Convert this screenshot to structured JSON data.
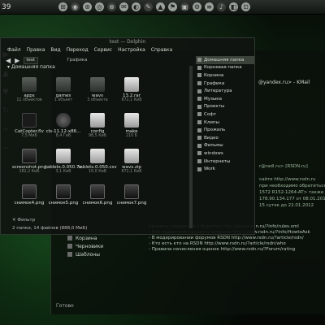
{
  "top_panel": {
    "time": "39",
    "icons": [
      "app-icon-1",
      "app-icon-2",
      "app-icon-3",
      "app-icon-4",
      "app-icon-5",
      "app-icon-6",
      "app-icon-7",
      "app-icon-8",
      "app-icon-9",
      "app-icon-10",
      "app-icon-11",
      "app-icon-12",
      "app-icon-13",
      "app-icon-14",
      "app-icon-15",
      "app-icon-16"
    ]
  },
  "fm": {
    "title": "test — Dolphin",
    "menu": [
      "Файл",
      "Правка",
      "Вид",
      "Переход",
      "Сервис",
      "Настройка",
      "Справка"
    ],
    "location": "test",
    "breadcrumb": "Графика",
    "home_label": "Домашняя папка",
    "files": [
      {
        "name": "apps",
        "size": "11 объектов",
        "icon": "folder"
      },
      {
        "name": "games",
        "size": "1 объект",
        "icon": "folder"
      },
      {
        "name": "wavs",
        "size": "3 объекта",
        "icon": "folder"
      },
      {
        "name": "13.2.rar",
        "size": "672,1 КиБ",
        "icon": "file"
      },
      {
        "name": "",
        "size": "",
        "icon": "empty"
      },
      {
        "name": "CatCopter.flv",
        "size": "7,5 МиБ",
        "icon": "dark"
      },
      {
        "name": "cls-11.12-x86...",
        "size": "8,4 ГиБ",
        "icon": "disc"
      },
      {
        "name": "config",
        "size": "98,5 КиБ",
        "icon": "file"
      },
      {
        "name": "make",
        "size": "210 Б",
        "icon": "file"
      },
      {
        "name": "",
        "size": "",
        "icon": "empty"
      },
      {
        "name": "screenshot.png",
        "size": "182,2 КиБ",
        "icon": "img"
      },
      {
        "name": "tablets.0.050.7z",
        "size": "3,1 КиБ",
        "icon": "file"
      },
      {
        "name": "tablets.0.050.csv",
        "size": "10,0 КиБ",
        "icon": "file"
      },
      {
        "name": "wavs.zip",
        "size": "672,1 КиБ",
        "icon": "file"
      },
      {
        "name": "",
        "size": "",
        "icon": "empty"
      },
      {
        "name": "снимок4.png",
        "size": "",
        "icon": "img"
      },
      {
        "name": "снимок5.png",
        "size": "",
        "icon": "img"
      },
      {
        "name": "снимок6.png",
        "size": "",
        "icon": "img"
      },
      {
        "name": "снимок7.png",
        "size": "",
        "icon": "img"
      }
    ],
    "filter_label": "Фильтр",
    "status": "2 папки, 14 файлов (888,0 МиБ)",
    "sidebar": [
      "Домашняя папка",
      "Корневая папка",
      "Корзина",
      "Графика",
      "Литература",
      "Музыка",
      "Проекты",
      "Софт",
      "Клипы",
      "Прожиль",
      "Видео",
      "Фильмы",
      "windows",
      "Интернеты",
      "Work"
    ]
  },
  "bg_window": {
    "email": "@yandex.ru> - KMail",
    "lines": [
      "r@radl.ru> [RSDN.ru]",
      "",
      "сайте http://www.rsdn.ru",
      "при необходимо обратиться",
      "1572 R152-1264-AT> также к",
      "178.90.134.177 от 08.01.2012",
      "15 суток до 22.01.2012"
    ],
    "forum": [
      "правила поведения в форумах http://www.rsdn.ru/?info/rules.xml",
      "- Как правильно задавать вопросы http://www.rsdn.ru/?info/HowtoAsk",
      "- В модерировании форумов RSDN http://www.rsdn.ru/?article/rsdn/",
      "- Кто есть кто на RSDN http://www.rsdn.ru/?article/rsdn/who",
      "- Правила начисления оценок http://www.rsdn.ru/?Forum/rating"
    ],
    "panel_list": [
      "Корзина",
      "Черновики",
      "Шаблоны"
    ],
    "ready": "Готово"
  }
}
